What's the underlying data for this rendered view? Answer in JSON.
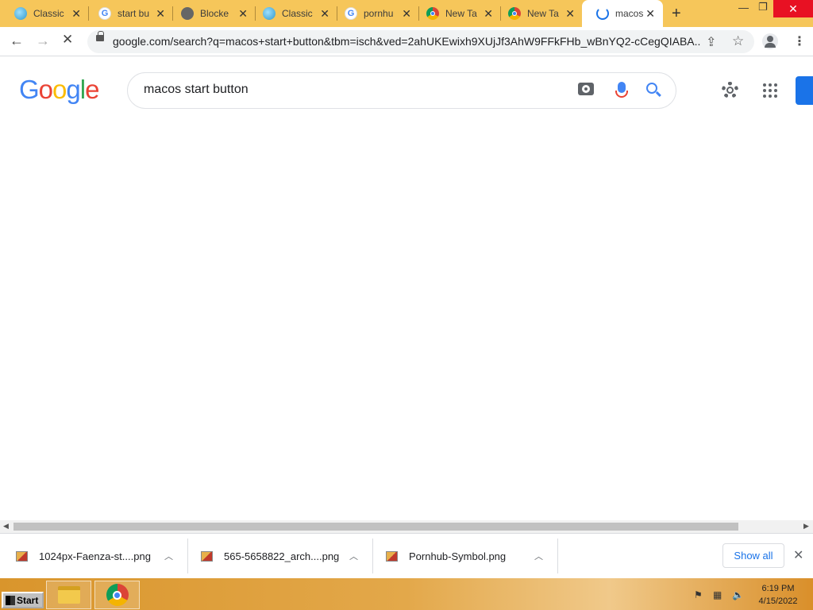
{
  "browser": {
    "tabs": [
      {
        "title": "Classic",
        "favicon": "globe-icon"
      },
      {
        "title": "start bu",
        "favicon": "google-g-icon"
      },
      {
        "title": "Blocke",
        "favicon": "blocked-globe-icon"
      },
      {
        "title": "Classic",
        "favicon": "globe-icon"
      },
      {
        "title": "pornhu",
        "favicon": "google-g-icon"
      },
      {
        "title": "New Ta",
        "favicon": "chrome-icon"
      },
      {
        "title": "New Ta",
        "favicon": "chrome-icon"
      },
      {
        "title": "macos",
        "favicon": "loading-spinner-icon",
        "active": true
      }
    ],
    "new_tab_label": "+",
    "url": "google.com/search?q=macos+start+button&tbm=isch&ved=2ahUKEwixh9XUjJf3AhW9FFkFHb_wBnYQ2-cCegQIABA..."
  },
  "google": {
    "logo_letters": [
      "G",
      "o",
      "o",
      "g",
      "l",
      "e"
    ],
    "logo_colors": [
      "#4285f4",
      "#ea4335",
      "#fbbc05",
      "#4285f4",
      "#34a853",
      "#ea4335"
    ],
    "query": "macos start button"
  },
  "downloads": {
    "items": [
      {
        "name": "1024px-Faenza-st....png"
      },
      {
        "name": "565-5658822_arch....png"
      },
      {
        "name": "Pornhub-Symbol.png"
      }
    ],
    "show_all_label": "Show all"
  },
  "taskbar": {
    "start_label": "Start",
    "clock_time": "6:19 PM",
    "clock_date": "4/15/2022"
  }
}
